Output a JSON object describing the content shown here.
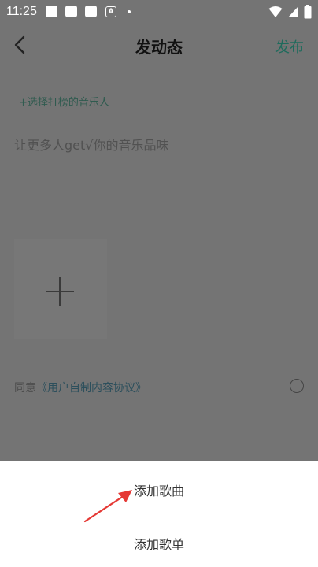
{
  "status_bar": {
    "time": "11:25",
    "notification_badge": "A"
  },
  "header": {
    "title": "发动态",
    "publish_label": "发布"
  },
  "compose": {
    "select_artist": "+选择打榜的音乐人",
    "placeholder": "让更多人get√你的音乐品味"
  },
  "agreement": {
    "prefix": "同意",
    "link_text": "《用户自制内容协议》"
  },
  "action_sheet": {
    "items": [
      {
        "label": "添加歌曲"
      },
      {
        "label": "添加歌单"
      }
    ]
  },
  "colors": {
    "accent_green": "#1e6b5c",
    "overlay": "#747474",
    "arrow_red": "#e53935"
  }
}
